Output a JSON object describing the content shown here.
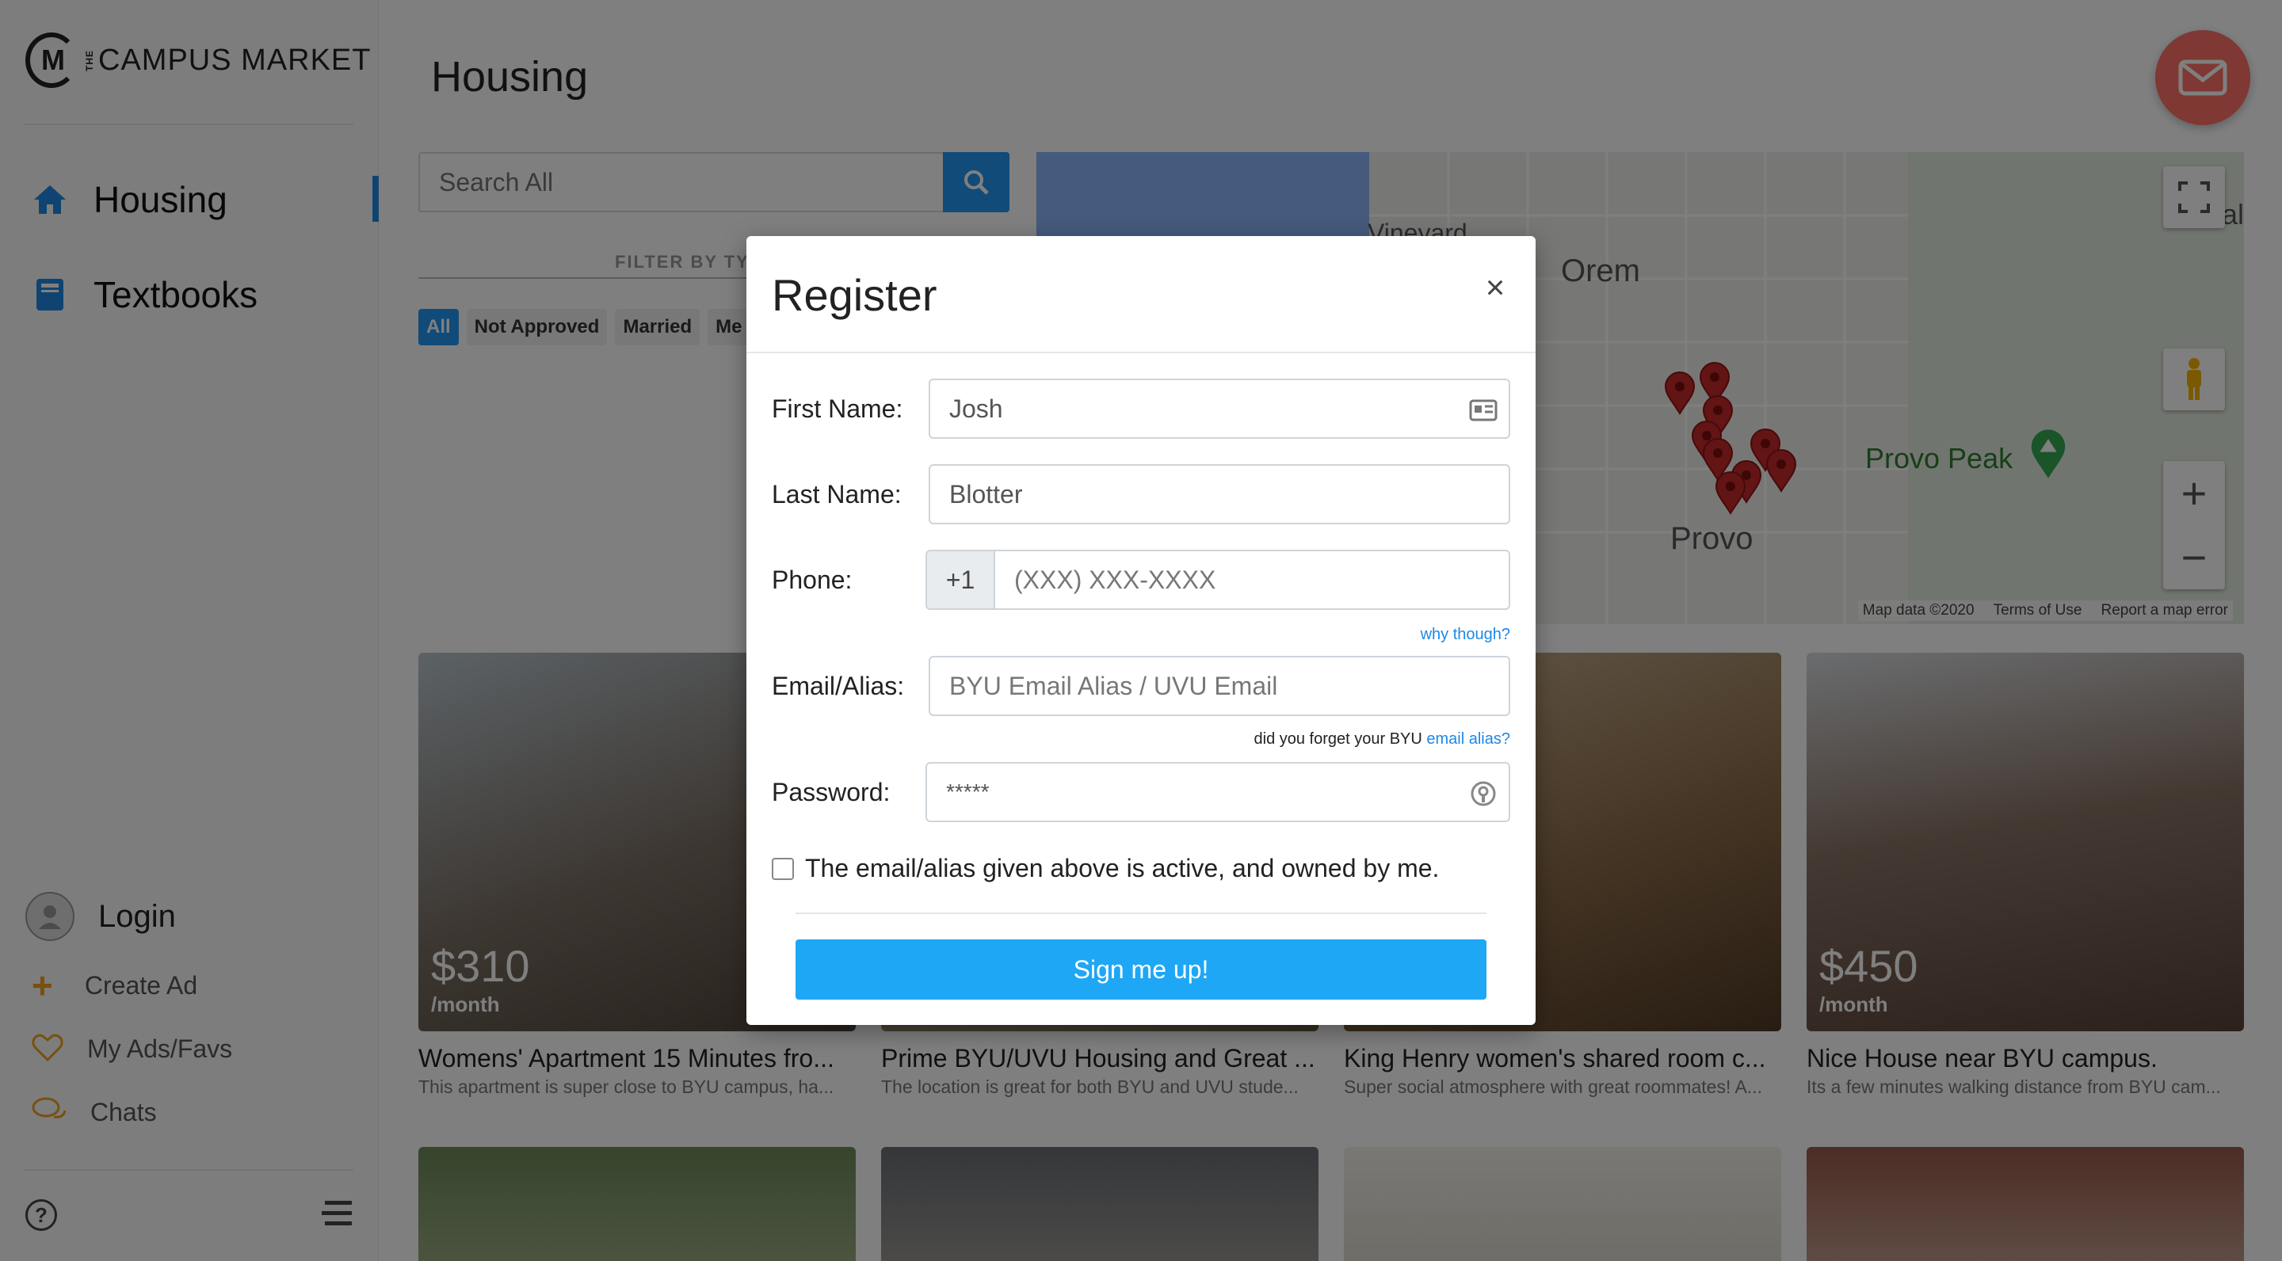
{
  "brand": {
    "mark_letter": "M",
    "the": "THE",
    "name": "CAMPUS MARKET"
  },
  "nav": [
    {
      "label": "Housing",
      "icon": "home-icon",
      "active": true
    },
    {
      "label": "Textbooks",
      "icon": "book-icon"
    }
  ],
  "account": {
    "login_label": "Login",
    "create_ad": "Create Ad",
    "my_ads": "My Ads/Favs",
    "chats": "Chats"
  },
  "page": {
    "title": "Housing"
  },
  "search": {
    "placeholder": "Search All"
  },
  "filter": {
    "label": "FILTER BY TY",
    "chips": [
      "All",
      "Not Approved",
      "Married",
      "Me"
    ]
  },
  "map": {
    "cities": [
      "Vineyard",
      "Orem",
      "Provo",
      "Provo Peak"
    ],
    "footer": [
      "Map data ©2020",
      "Terms of Use",
      "Report a map error"
    ],
    "edge_text": "al"
  },
  "listings": [
    {
      "price": "$310",
      "per": "/month",
      "title": "Womens' Apartment 15 Minutes fro...",
      "desc": "This apartment is super close to BYU campus, ha..."
    },
    {
      "price": "",
      "per": "",
      "title": "Prime BYU/UVU Housing and Great ...",
      "desc": "The location is great for both BYU and UVU stude..."
    },
    {
      "price": "",
      "per": "",
      "title": "King Henry women's shared room c...",
      "desc": "Super social atmosphere with great roommates! A..."
    },
    {
      "price": "$450",
      "per": "/month",
      "title": "Nice House near BYU campus.",
      "desc": "Its a few minutes walking distance from BYU cam..."
    }
  ],
  "modal": {
    "title": "Register",
    "close": "×",
    "first_name_label": "First Name:",
    "first_name_value": "Josh",
    "last_name_label": "Last Name:",
    "last_name_value": "Blotter",
    "phone_label": "Phone:",
    "phone_prefix": "+1",
    "phone_placeholder": "(XXX) XXX-XXXX",
    "why_link": "why though?",
    "email_label": "Email/Alias:",
    "email_placeholder": "BYU Email Alias / UVU Email",
    "forgot_text": "did you forget your BYU ",
    "forgot_link": "email alias?",
    "password_label": "Password:",
    "password_value": "*****",
    "check_label": "The email/alias given above is active, and owned by me.",
    "submit": "Sign me up!"
  },
  "colors": {
    "accent": "#2196f3",
    "fab": "#ff7066",
    "submit": "#1ea7f5"
  }
}
